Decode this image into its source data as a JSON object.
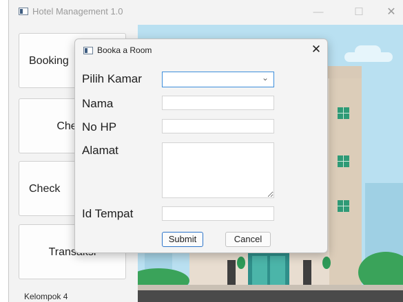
{
  "window": {
    "title": "Hotel Management 1.0",
    "controls": {
      "minimize": "—",
      "maximize": "☐",
      "close": "✕"
    }
  },
  "sidebar": {
    "items": [
      {
        "label": "Booking"
      },
      {
        "label": "Check"
      },
      {
        "label": "Check"
      },
      {
        "label": "Transaksi"
      }
    ],
    "footer": "Kelompok 4"
  },
  "dialog": {
    "title": "Booka a Room",
    "close": "✕",
    "fields": {
      "room": {
        "label": "Pilih Kamar",
        "value": ""
      },
      "name": {
        "label": "Nama",
        "value": ""
      },
      "phone": {
        "label": "No HP",
        "value": ""
      },
      "address": {
        "label": "Alamat",
        "value": ""
      },
      "place_id": {
        "label": "Id Tempat",
        "value": ""
      }
    },
    "buttons": {
      "submit": "Submit",
      "cancel": "Cancel"
    }
  },
  "colors": {
    "sky": "#b9e0f1",
    "building": "#e8ddd0",
    "accent_blue": "#3b8ddb"
  }
}
